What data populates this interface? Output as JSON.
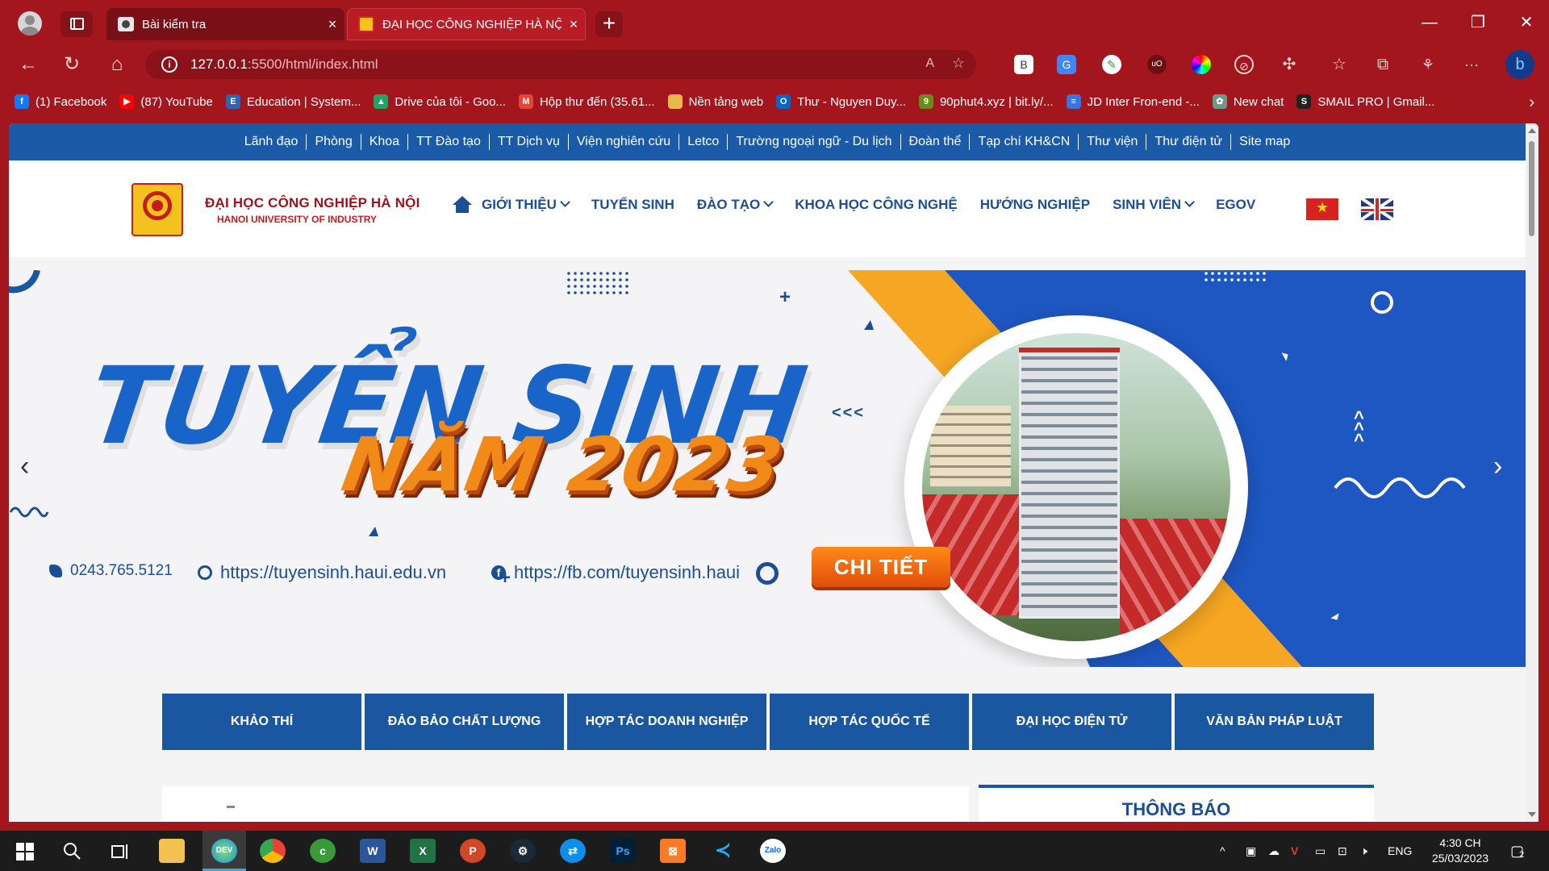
{
  "browser": {
    "tabs": [
      {
        "title": "Bài kiểm tra",
        "active": false
      },
      {
        "title": "ĐẠI HỌC CÔNG NGHIỆP HÀ NỘI",
        "active": true
      }
    ],
    "close_glyph": "×",
    "new_tab_glyph": "+",
    "window_buttons": {
      "minimize": "—",
      "restore": "❐",
      "close": "✕"
    },
    "url_host": "127.0.0.1",
    "url_rest": ":5500/html/index.html",
    "nav_glyphs": {
      "back": "←",
      "reload": "↻",
      "home": "⌂",
      "more": "···"
    },
    "bookmarks": [
      {
        "label": "(1) Facebook",
        "icon": "facebook-icon",
        "color": "#1877f2",
        "glyph": "f"
      },
      {
        "label": "(87) YouTube",
        "icon": "youtube-icon",
        "color": "#ff0000",
        "glyph": "▶"
      },
      {
        "label": "Education | System...",
        "icon": "education-icon",
        "color": "#2d64b3",
        "glyph": "E"
      },
      {
        "label": "Drive của tôi - Goo...",
        "icon": "drive-icon",
        "color": "#1fa463",
        "glyph": "▲"
      },
      {
        "label": "Hộp thư đến (35.61...",
        "icon": "gmail-icon",
        "color": "#ea4335",
        "glyph": "M"
      },
      {
        "label": "Nền tảng web",
        "icon": "folder-icon",
        "color": "#e8b84a",
        "glyph": ""
      },
      {
        "label": "Thư - Nguyen Duy...",
        "icon": "outlook-icon",
        "color": "#0a64c8",
        "glyph": "O"
      },
      {
        "label": "90phut4.xyz | bit.ly/...",
        "icon": "90phut-icon",
        "color": "#6a8a1a",
        "glyph": "9"
      },
      {
        "label": "JD Inter Fron-end -...",
        "icon": "docs-icon",
        "color": "#3b73d9",
        "glyph": "≡"
      },
      {
        "label": "New chat",
        "icon": "chatgpt-icon",
        "color": "#6b9a8a",
        "glyph": "✿"
      },
      {
        "label": "SMAIL PRO | Gmail...",
        "icon": "smail-icon",
        "color": "#222222",
        "glyph": "S"
      }
    ],
    "bookmarks_more": "›"
  },
  "page": {
    "top_links": [
      "Lãnh đạo",
      "Phòng",
      "Khoa",
      "TT Đào tạo",
      "TT Dịch vụ",
      "Viện nghiên cứu",
      "Letco",
      "Trường ngoại ngữ - Du lịch",
      "Đoàn thể",
      "Tạp chí KH&CN",
      "Thư viện",
      "Thư điện tử",
      "Site map"
    ],
    "logo_title": "ĐẠI HỌC CÔNG NGHIỆP HÀ NỘI",
    "logo_subtitle": "HANOI UNIVERSITY OF INDUSTRY",
    "main_nav": [
      {
        "label": "GIỚI THIỆU",
        "dropdown": true
      },
      {
        "label": "TUYỂN SINH",
        "dropdown": false
      },
      {
        "label": "ĐÀO TẠO",
        "dropdown": true
      },
      {
        "label": "KHOA HỌC CÔNG NGHỆ",
        "dropdown": false
      },
      {
        "label": "HƯỚNG NGHIỆP",
        "dropdown": false
      },
      {
        "label": "SINH VIÊN",
        "dropdown": true
      },
      {
        "label": "EGOV",
        "dropdown": false
      }
    ],
    "banner": {
      "headline": "TUYỂN SINH",
      "year_line": "NĂM 2023",
      "phone": "0243.765.5121",
      "website": "https://tuyensinh.haui.edu.vn",
      "facebook": "https://fb.com/tuyensinh.haui",
      "cta": "CHI TIẾT",
      "prev_glyph": "‹",
      "next_glyph": "›",
      "deco_chevrons": "<<<"
    },
    "tiles": [
      "KHẢO THÍ",
      "ĐẢO BẢO CHẤT LƯỢNG",
      "HỢP TÁC DOANH NGHIỆP",
      "HỢP TÁC QUỐC TẾ",
      "ĐẠI HỌC ĐIỆN TỬ",
      "VĂN BẢN PHÁP LUẬT"
    ],
    "notice_title": "THÔNG BÁO"
  },
  "taskbar": {
    "apps": [
      "File Explorer",
      "Edge Dev",
      "Chrome",
      "Cốc Cốc",
      "Word",
      "Excel",
      "PowerPoint",
      "Steam",
      "TeamViewer",
      "Photoshop",
      "XAMPP",
      "VS Code",
      "Zalo"
    ],
    "language": "ENG",
    "time": "4:30 CH",
    "date": "25/03/2023",
    "notification_count": "2"
  },
  "colors": {
    "chrome": "#a4161d",
    "brand_blue": "#1a57a0",
    "brand_red": "#a3121a",
    "accent_orange": "#f28a1a"
  }
}
